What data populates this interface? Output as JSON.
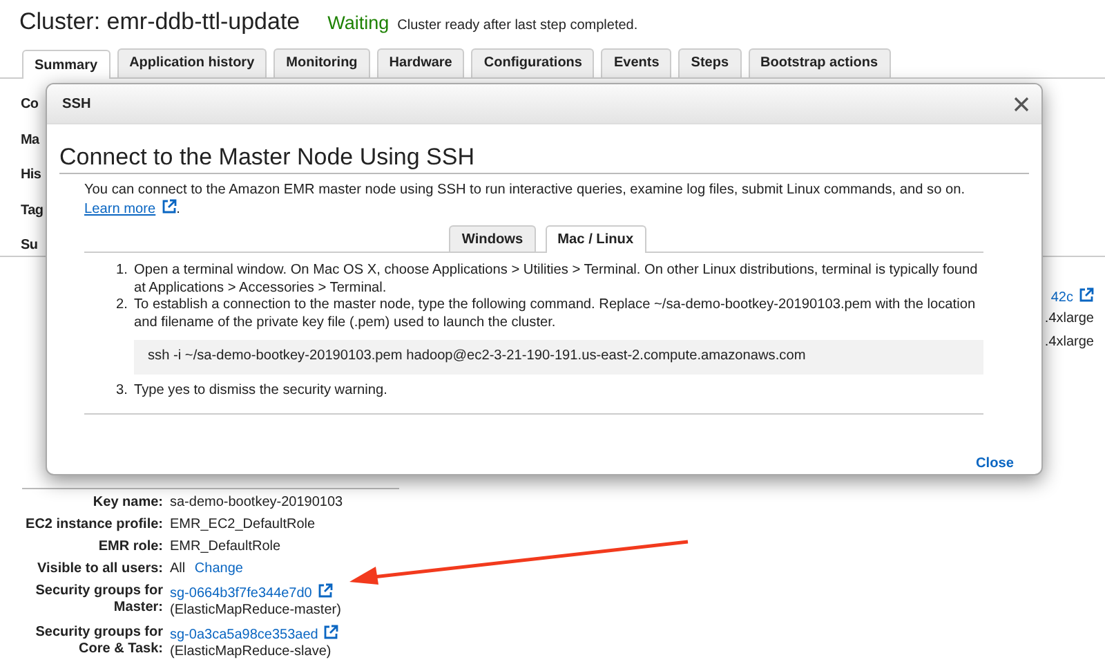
{
  "cluster": {
    "title": "Cluster: emr-ddb-ttl-update",
    "status": "Waiting",
    "status_message": "Cluster ready after last step completed."
  },
  "tabs": [
    {
      "label": "Summary",
      "selected": true
    },
    {
      "label": "Application history",
      "selected": false
    },
    {
      "label": "Monitoring",
      "selected": false
    },
    {
      "label": "Hardware",
      "selected": false
    },
    {
      "label": "Configurations",
      "selected": false
    },
    {
      "label": "Events",
      "selected": false
    },
    {
      "label": "Steps",
      "selected": false
    },
    {
      "label": "Bootstrap actions",
      "selected": false
    }
  ],
  "background_left": [
    "Co",
    "Ma",
    "His",
    "Tag",
    "Su"
  ],
  "background_right": [
    {
      "text": "42c",
      "kind": "link"
    },
    {
      "text": ".4xlarge",
      "kind": "text"
    },
    {
      "text": ".4xlarge",
      "kind": "text"
    }
  ],
  "security": [
    {
      "label": "Key name:",
      "value": "sa-demo-bootkey-20190103"
    },
    {
      "label": "EC2 instance profile:",
      "value": "EMR_EC2_DefaultRole"
    },
    {
      "label": "EMR role:",
      "value": "EMR_DefaultRole"
    },
    {
      "label": "Visible to all users:",
      "value": "All",
      "action": "Change"
    },
    {
      "label": "Security groups for\nMaster:",
      "link": "sg-0664b3f7fe344e7d0",
      "note": "(ElasticMapReduce-master)"
    },
    {
      "label": "Security groups for\nCore & Task:",
      "link": "sg-0a3ca5a98ce353aed",
      "note": "(ElasticMapReduce-slave)"
    }
  ],
  "modal": {
    "header": "SSH",
    "heading": "Connect to the Master Node Using SSH",
    "intro": "You can connect to the Amazon EMR master node using SSH to run interactive queries, examine log files, submit Linux commands, and so on.",
    "learn_more": "Learn more",
    "intro_end": ".",
    "tabs": [
      {
        "label": "Windows",
        "selected": false
      },
      {
        "label": "Mac / Linux",
        "selected": true
      }
    ],
    "steps": [
      {
        "number": "1.",
        "text": "Open a terminal window. On Mac OS X, choose Applications > Utilities > Terminal. On other Linux distributions, terminal is typically found at Applications > Accessories > Terminal."
      },
      {
        "number": "2.",
        "text": "To establish a connection to the master node, type the following command. Replace ~/sa-demo-bootkey-20190103.pem with the location and filename of the private key file (.pem) used to launch the cluster.",
        "code": "ssh -i ~/sa-demo-bootkey-20190103.pem hadoop@ec2-3-21-190-191.us-east-2.compute.amazonaws.com"
      },
      {
        "number": "3.",
        "text": "Type yes to dismiss the security warning."
      }
    ],
    "close_button": "Close"
  }
}
